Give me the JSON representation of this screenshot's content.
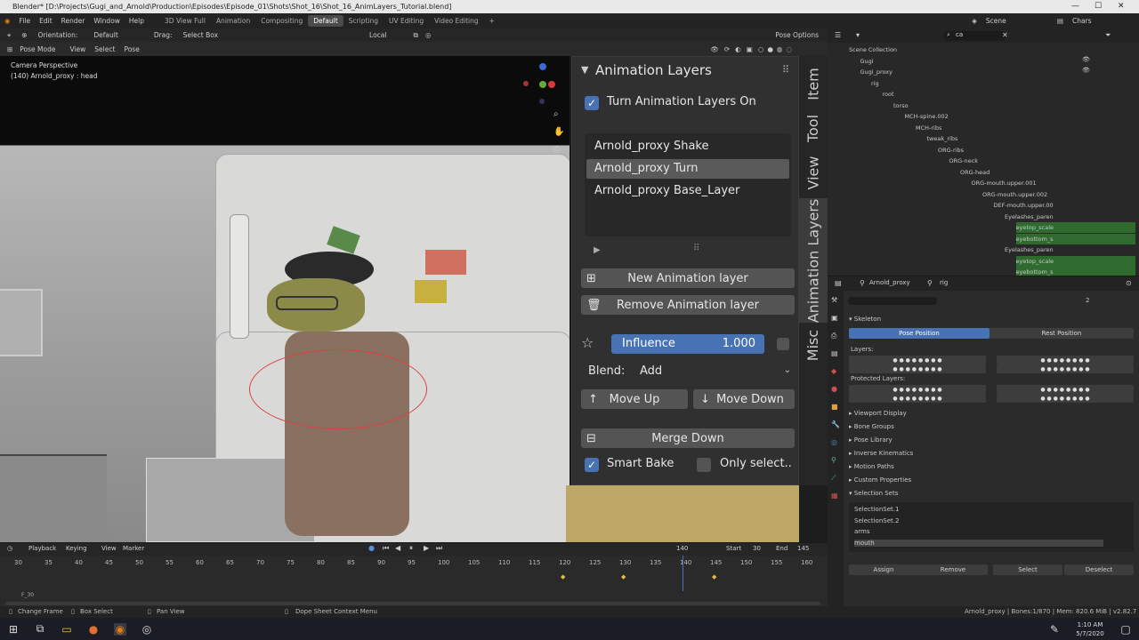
{
  "window": {
    "title": "Blender* [D:\\Projects\\Gugi_and_Arnold\\Production\\Episodes\\Episode_01\\Shots\\Shot_16\\Shot_16_AnimLayers_Tutorial.blend]"
  },
  "menu": {
    "items": [
      "File",
      "Edit",
      "Render",
      "Window",
      "Help"
    ]
  },
  "workspaces": [
    {
      "label": "3D View Full",
      "active": false
    },
    {
      "label": "Animation",
      "active": false
    },
    {
      "label": "Compositing",
      "active": false
    },
    {
      "label": "Default",
      "active": true
    },
    {
      "label": "Scripting",
      "active": false
    },
    {
      "label": "UV Editing",
      "active": false
    },
    {
      "label": "Video Editing",
      "active": false
    },
    {
      "label": "+",
      "active": false
    }
  ],
  "scene": {
    "label": "Scene",
    "view_layer": "Chars"
  },
  "viewport_header": {
    "orientation_label": "Orientation:",
    "orientation_value": "Default",
    "drag_label": "Drag:",
    "drag_value": "Select Box",
    "transform": "Local",
    "pose_options": "Pose Options"
  },
  "viewport_header2": {
    "mode": "Pose Mode",
    "view": "View",
    "select": "Select",
    "pose": "Pose"
  },
  "viewport": {
    "info_line1": "Camera Perspective",
    "info_line2": "(140) Arnold_proxy : head"
  },
  "anim_panel": {
    "title": "Animation Layers",
    "turn_on_label": "Turn Animation Layers On",
    "turn_on_checked": true,
    "layers": [
      {
        "name": "Arnold_proxy Shake",
        "selected": false
      },
      {
        "name": "Arnold_proxy Turn",
        "selected": true
      },
      {
        "name": "Arnold_proxy Base_Layer",
        "selected": false
      }
    ],
    "new_layer": "New Animation layer",
    "remove_layer": "Remove Animation layer",
    "influence_label": "Influence",
    "influence_value": "1.000",
    "blend_label": "Blend:",
    "blend_value": "Add",
    "move_up": "Move Up",
    "move_down": "Move Down",
    "merge_down": "Merge Down",
    "smart_bake": "Smart Bake",
    "smart_bake_checked": true,
    "only_selected": "Only select..",
    "only_selected_checked": false
  },
  "side_tabs": [
    {
      "label": "Item",
      "active": false
    },
    {
      "label": "Tool",
      "active": false
    },
    {
      "label": "View",
      "active": false
    },
    {
      "label": "Animation Layers",
      "active": true
    },
    {
      "label": "Misc",
      "active": false
    }
  ],
  "outliner": {
    "search": "ca",
    "rows": [
      {
        "label": "Scene Collection",
        "depth": 0,
        "hl": false
      },
      {
        "label": "Gugi",
        "depth": 1,
        "hl": false
      },
      {
        "label": "Gugi_proxy",
        "depth": 1,
        "hl": false
      },
      {
        "label": "rig",
        "depth": 2,
        "hl": false
      },
      {
        "label": "root",
        "depth": 3,
        "hl": false
      },
      {
        "label": "torso",
        "depth": 4,
        "hl": false
      },
      {
        "label": "MCH-spine.002",
        "depth": 5,
        "hl": false
      },
      {
        "label": "MCH-ribs",
        "depth": 6,
        "hl": false
      },
      {
        "label": "tweak_ribs",
        "depth": 7,
        "hl": false
      },
      {
        "label": "ORG-ribs",
        "depth": 8,
        "hl": false
      },
      {
        "label": "ORG-neck",
        "depth": 9,
        "hl": false
      },
      {
        "label": "ORG-head",
        "depth": 10,
        "hl": false
      },
      {
        "label": "ORG-mouth.upper.001",
        "depth": 11,
        "hl": false
      },
      {
        "label": "ORG-mouth.upper.002",
        "depth": 12,
        "hl": false
      },
      {
        "label": "DEF-mouth.upper.00",
        "depth": 13,
        "hl": false
      },
      {
        "label": "Eyelashes_paren",
        "depth": 14,
        "hl": false
      },
      {
        "label": "eyetop_scale",
        "depth": 15,
        "hl": true
      },
      {
        "label": "eyebottom_s",
        "depth": 15,
        "hl": true
      },
      {
        "label": "Eyelashes_paren",
        "depth": 14,
        "hl": false
      },
      {
        "label": "eyetop_scale",
        "depth": 15,
        "hl": true
      },
      {
        "label": "eyebottom_s",
        "depth": 15,
        "hl": true
      }
    ]
  },
  "properties": {
    "object": "Arnold_proxy",
    "data": "rig",
    "count": "2",
    "skeleton": "Skeleton",
    "pose_position": "Pose Position",
    "rest_position": "Rest Position",
    "layers_label": "Layers:",
    "protected_label": "Protected Layers:",
    "sections": [
      "Viewport Display",
      "Bone Groups",
      "Pose Library",
      "Inverse Kinematics",
      "Motion Paths",
      "Custom Properties",
      "Selection Sets"
    ],
    "selection_sets": [
      "SelectionSet.1",
      "SelectionSet.2",
      "arms",
      "mouth"
    ],
    "buttons": [
      "Assign",
      "Remove",
      "Select",
      "Deselect"
    ]
  },
  "timeline": {
    "menus": [
      "Playback",
      "Keying",
      "View",
      "Marker"
    ],
    "current_frame": "140",
    "start_label": "Start",
    "start": "30",
    "end_label": "End",
    "end": "145",
    "ticks": [
      "30",
      "35",
      "40",
      "45",
      "50",
      "55",
      "60",
      "65",
      "70",
      "75",
      "80",
      "85",
      "90",
      "95",
      "100",
      "105",
      "110",
      "115",
      "120",
      "125",
      "130",
      "135",
      "140",
      "145",
      "150",
      "155",
      "160"
    ],
    "frame_note": "F_30"
  },
  "status": {
    "left": [
      "Change Frame",
      "Box Select",
      "Pan View",
      "Dope Sheet Context Menu"
    ],
    "right": "Arnold_proxy | Bones:1/870 | Mem: 820.6 MiB | v2.82.7"
  },
  "taskbar": {
    "time": "1:10 AM",
    "date": "5/7/2020"
  },
  "colors": {
    "accent": "#4772b3",
    "highlight_row": "#2f6b2f"
  }
}
